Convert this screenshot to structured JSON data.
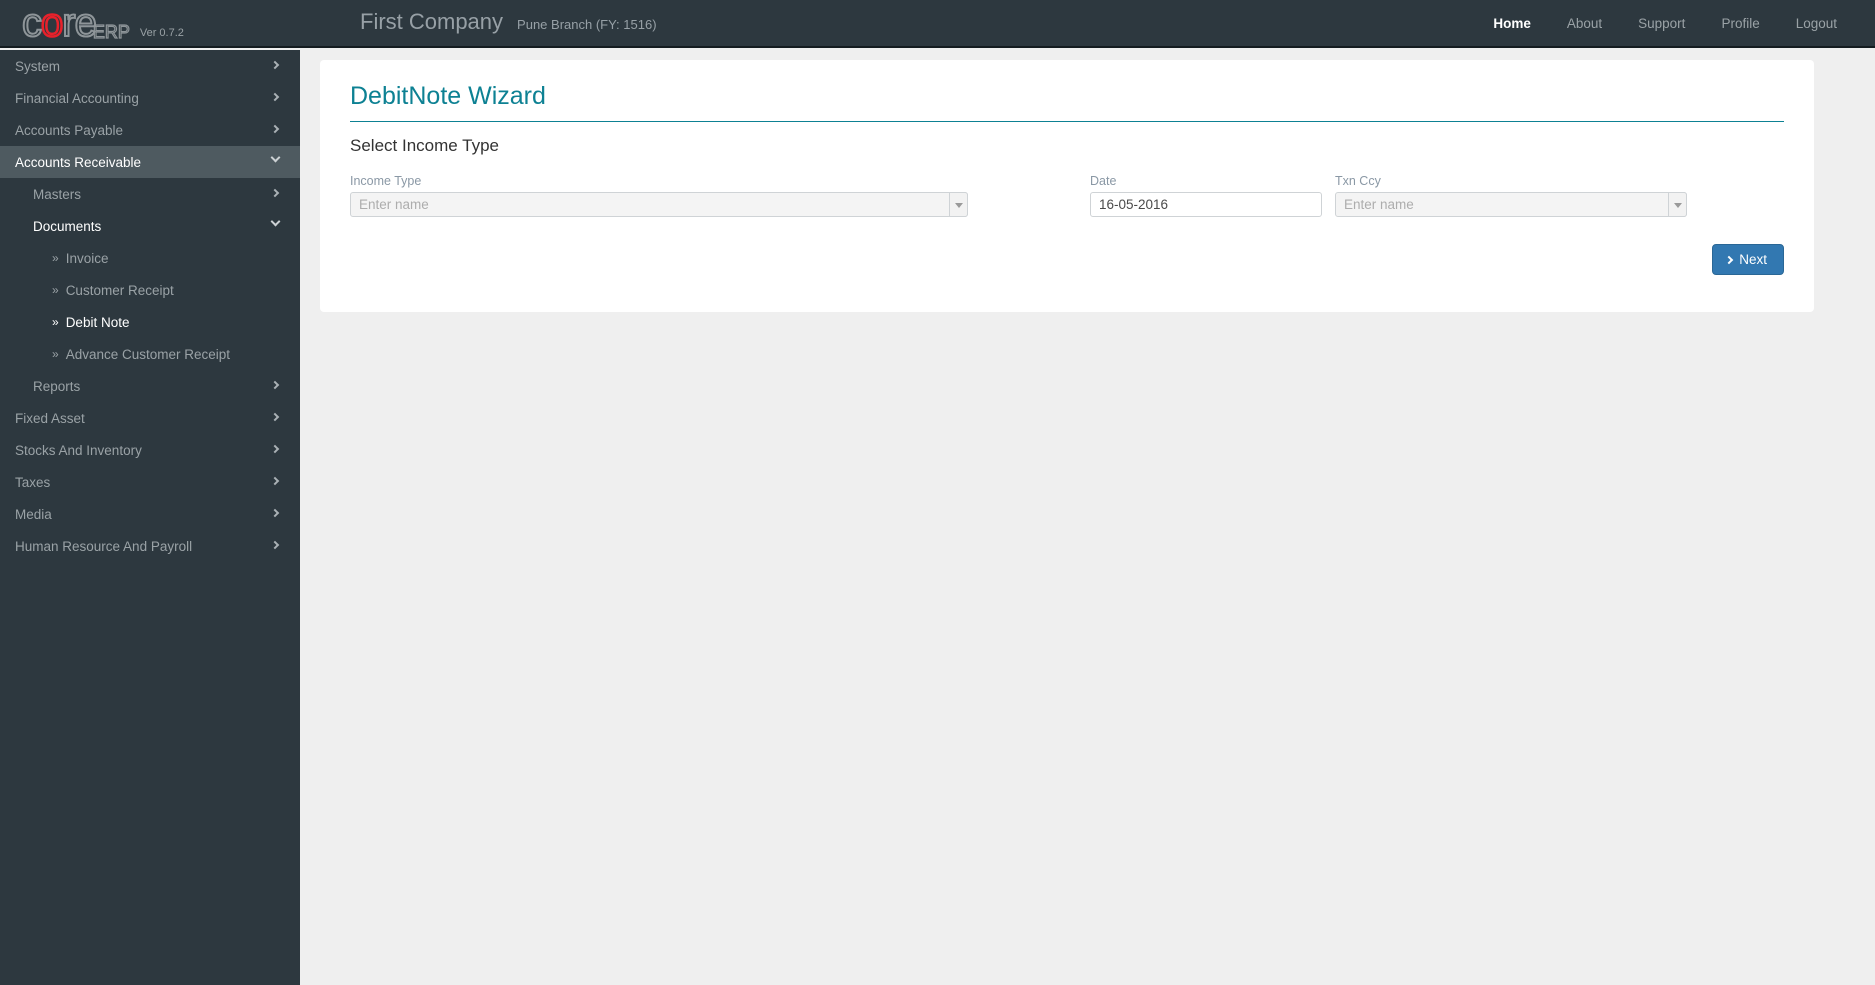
{
  "header": {
    "logo": {
      "letters": [
        "c",
        "o",
        "r",
        "e"
      ],
      "red_letter_index": 1,
      "suffix": "ERP",
      "version": "Ver 0.7.2",
      "red_color": "#e8212b",
      "outline_color": "#8e9599"
    },
    "company_name": "First Company",
    "branch": "Pune Branch (FY: 1516)",
    "nav": [
      {
        "label": "Home",
        "active": true,
        "name": "nav-home"
      },
      {
        "label": "About",
        "active": false,
        "name": "nav-about"
      },
      {
        "label": "Support",
        "active": false,
        "name": "nav-support"
      },
      {
        "label": "Profile",
        "active": false,
        "name": "nav-profile"
      },
      {
        "label": "Logout",
        "active": false,
        "name": "nav-logout"
      }
    ]
  },
  "sidebar": {
    "items": [
      {
        "label": "System",
        "level": 1,
        "icon": "chevron-right-icon",
        "state": "collapsed"
      },
      {
        "label": "Financial Accounting",
        "level": 1,
        "icon": "chevron-right-icon",
        "state": "collapsed"
      },
      {
        "label": "Accounts Payable",
        "level": 1,
        "icon": "chevron-right-icon",
        "state": "collapsed"
      },
      {
        "label": "Accounts Receivable",
        "level": 1,
        "icon": "chevron-down-icon",
        "state": "expanded-active"
      },
      {
        "label": "Masters",
        "level": 2,
        "icon": "chevron-right-icon",
        "state": "collapsed"
      },
      {
        "label": "Documents",
        "level": 2,
        "icon": "chevron-down-icon",
        "state": "expanded"
      },
      {
        "label": "Invoice",
        "level": 3,
        "icon": "none",
        "state": "normal"
      },
      {
        "label": "Customer Receipt",
        "level": 3,
        "icon": "none",
        "state": "normal"
      },
      {
        "label": "Debit Note",
        "level": 3,
        "icon": "none",
        "state": "current"
      },
      {
        "label": "Advance Customer Receipt",
        "level": 3,
        "icon": "none",
        "state": "normal"
      },
      {
        "label": "Reports",
        "level": 2,
        "icon": "chevron-right-icon",
        "state": "collapsed"
      },
      {
        "label": "Fixed Asset",
        "level": 1,
        "icon": "chevron-right-icon",
        "state": "collapsed"
      },
      {
        "label": "Stocks And Inventory",
        "level": 1,
        "icon": "chevron-right-icon",
        "state": "collapsed"
      },
      {
        "label": "Taxes",
        "level": 1,
        "icon": "chevron-right-icon",
        "state": "collapsed"
      },
      {
        "label": "Media",
        "level": 1,
        "icon": "chevron-right-icon",
        "state": "collapsed"
      },
      {
        "label": "Human Resource And Payroll",
        "level": 1,
        "icon": "chevron-right-icon",
        "state": "collapsed"
      }
    ],
    "bullet_glyph": "»"
  },
  "main": {
    "panel_title": "DebitNote Wizard",
    "section_title": "Select Income Type",
    "fields": {
      "income_type": {
        "label": "Income Type",
        "value": "",
        "placeholder": "Enter name",
        "has_dropdown": true
      },
      "date": {
        "label": "Date",
        "value": "16-05-2016",
        "placeholder": "",
        "has_dropdown": false
      },
      "txn_ccy": {
        "label": "Txn Ccy",
        "value": "",
        "placeholder": "Enter name",
        "has_dropdown": true
      }
    },
    "next_button": {
      "label": "Next",
      "icon": "chevron-right-icon",
      "color": "#3278b1"
    }
  },
  "colors": {
    "sidebar_bg": "#2d383f",
    "sidebar_active": "#4e5a60",
    "page_bg": "#efefef",
    "panel_bg": "#ffffff",
    "accent_teal": "#0d8193",
    "button_blue": "#3278b1"
  }
}
